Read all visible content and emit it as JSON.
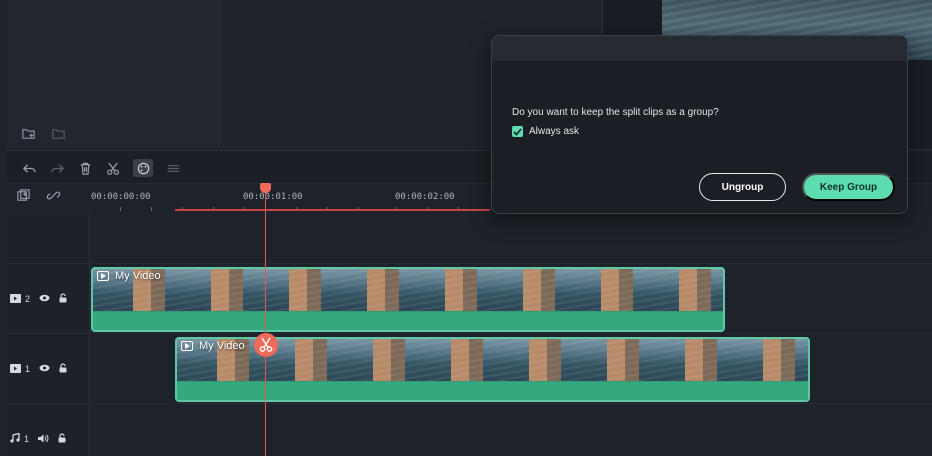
{
  "media_panel": {
    "tools": [
      {
        "icon": "new-folder-icon"
      },
      {
        "icon": "folder-icon"
      }
    ]
  },
  "timeline": {
    "toolbar": [
      {
        "icon": "undo-icon"
      },
      {
        "icon": "redo-icon"
      },
      {
        "icon": "trash-icon"
      },
      {
        "icon": "scissors-icon"
      },
      {
        "icon": "palette-icon"
      },
      {
        "icon": "adjust-icon"
      }
    ],
    "ruler_tools": [
      {
        "icon": "add-track-icon"
      },
      {
        "icon": "link-icon"
      }
    ],
    "timecodes": [
      "00:00:00:00",
      "00:00:01:00",
      "00:00:02:00"
    ],
    "tracks": [
      {
        "number": "2",
        "type_icon": "video-track-icon",
        "clip_label": "My Video"
      },
      {
        "number": "1",
        "type_icon": "video-track-icon",
        "clip_label": "My Video"
      },
      {
        "number": "1",
        "type_icon": "audio-track-icon"
      }
    ]
  },
  "dialog": {
    "message": "Do you want to keep the split clips as a group?",
    "checkbox_label": "Always ask",
    "checkbox_checked": true,
    "ungroup_label": "Ungroup",
    "keep_group_label": "Keep Group"
  },
  "colors": {
    "accent": "#5ddbb1",
    "clip": "#2f9c74",
    "playhead": "#e0585a"
  }
}
